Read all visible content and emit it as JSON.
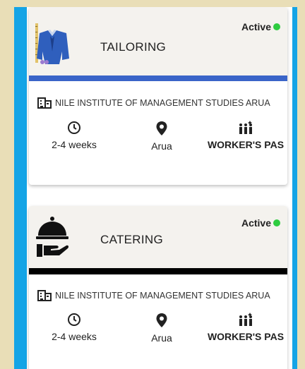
{
  "courses": [
    {
      "status": "Active",
      "title": "TAILORING",
      "icon": "tailoring-suit-icon",
      "strip_color": "#3a64c8",
      "institute": "NILE INSTITUTE OF MANAGEMENT STUDIES ARUA",
      "duration": "2-4 weeks",
      "location": "Arua",
      "requirement": "WORKER'S PAS"
    },
    {
      "status": "Active",
      "title": "CATERING",
      "icon": "catering-cloche-icon",
      "strip_color": "#000000",
      "institute": "NILE INSTITUTE OF MANAGEMENT STUDIES ARUA",
      "duration": "2-4 weeks",
      "location": "Arua",
      "requirement": "WORKER'S PAS"
    }
  ],
  "colors": {
    "page_background": "#e9deb7",
    "frame_blue": "#14a4e6",
    "active_dot": "#2ecc40"
  }
}
